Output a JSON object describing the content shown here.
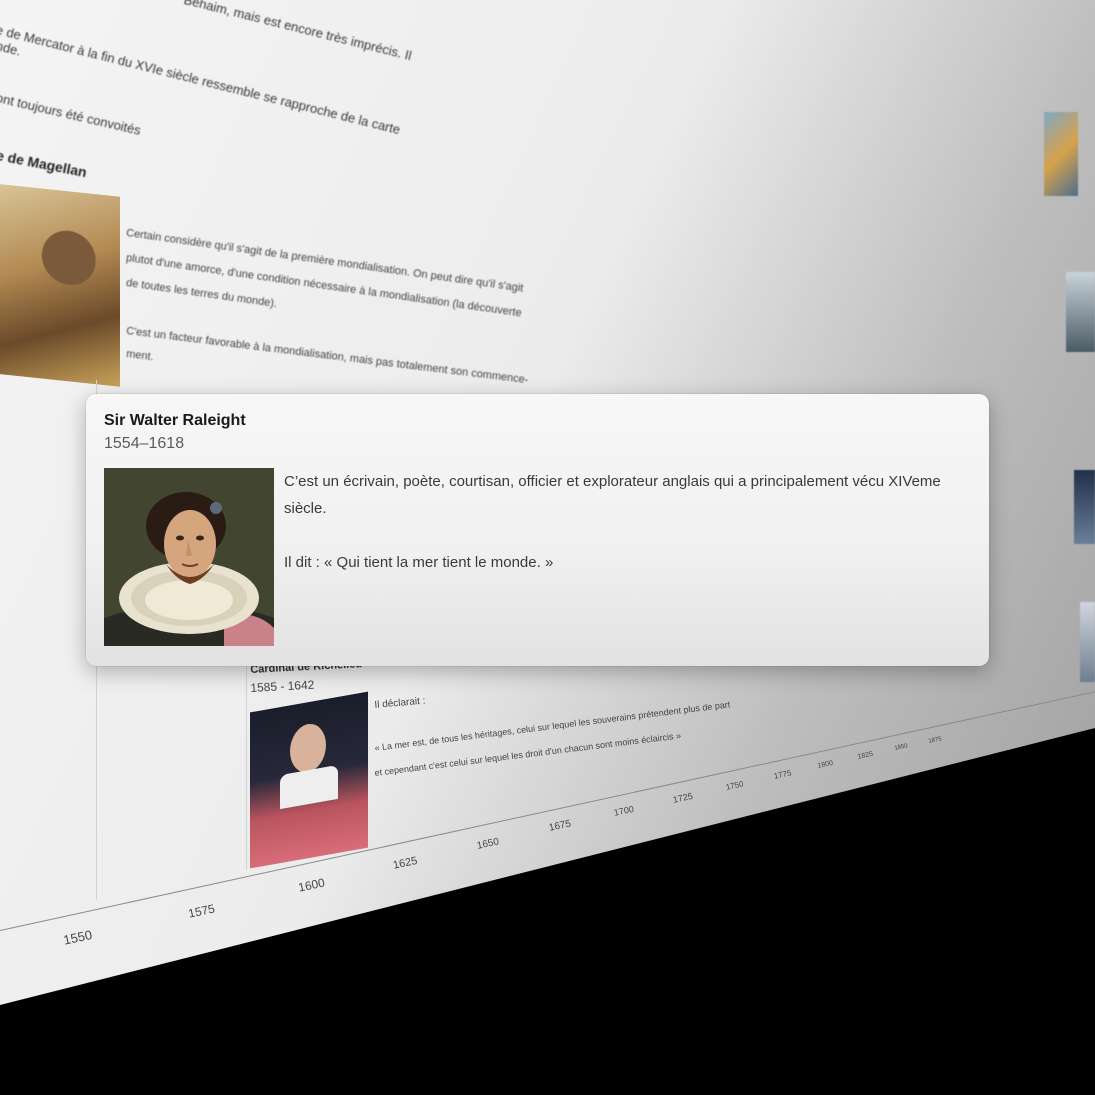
{
  "background": {
    "paragraph_lines": [
      "Behaim, mais est encore très imprécis. Il",
      "e de Mercator à la fin du XVIe siècle ressemble se rapproche de la carte",
      "nde.",
      "ont toujours été convoités"
    ],
    "magellan_heading": "e de Magellan",
    "magellan_text": [
      "Certain considère qu'il s'agit de la première mondialisation. On peut dire qu'il s'agit",
      "plutot d'une amorce, d'une condition nécessaire à la mondialisation (la découverte",
      "de toutes les terres du monde).",
      "C'est un facteur favorable à la mondialisation, mais pas totalement son commence-",
      "ment."
    ],
    "richelieu": {
      "name": "Cardinal de Richelieu",
      "dates": "1585 - 1642",
      "quote_intro": "Il déclarait :",
      "quote_lines": [
        "« La mer est, de tous les héritages, celui sur lequel les souverains prétendent plus de part",
        "et cependant c'est celui sur lequel les droit d'un chacun sont moins éclaircis »"
      ]
    },
    "timeline_ticks": [
      "1550",
      "1575",
      "1600",
      "1625",
      "1650",
      "1675",
      "1700",
      "1725",
      "1750",
      "1775",
      "1800",
      "1825",
      "1850",
      "1875"
    ]
  },
  "popup": {
    "name": "Sir Walter Raleight",
    "dates": "1554–1618",
    "portrait_icon": "portrait-raleigh",
    "text_paragraph": "C’est un écrivain, poète, courtisan, officier et explorateur anglais qui a principalement vécu XIVeme siècle.",
    "quote": "Il dit : «  Qui tient la mer tient le monde. »"
  }
}
